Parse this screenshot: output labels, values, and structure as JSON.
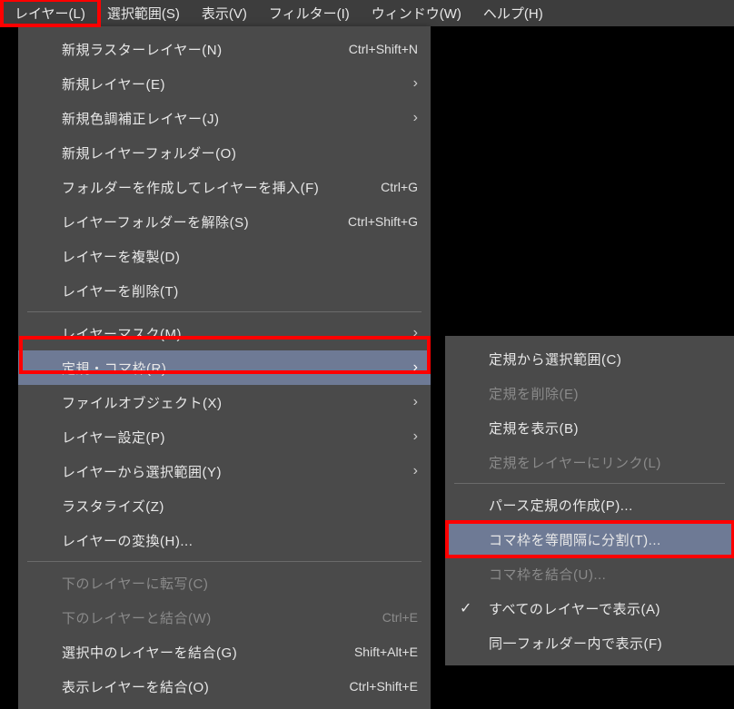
{
  "menubar": [
    "レイヤー(L)",
    "選択範囲(S)",
    "表示(V)",
    "フィルター(I)",
    "ウィンドウ(W)",
    "ヘルプ(H)"
  ],
  "mainMenu": {
    "items": [
      {
        "label": "新規ラスターレイヤー(N)",
        "shortcut": "Ctrl+Shift+N"
      },
      {
        "label": "新規レイヤー(E)",
        "arrow": true
      },
      {
        "label": "新規色調補正レイヤー(J)",
        "arrow": true
      },
      {
        "label": "新規レイヤーフォルダー(O)"
      },
      {
        "label": "フォルダーを作成してレイヤーを挿入(F)",
        "shortcut": "Ctrl+G"
      },
      {
        "label": "レイヤーフォルダーを解除(S)",
        "shortcut": "Ctrl+Shift+G"
      },
      {
        "label": "レイヤーを複製(D)"
      },
      {
        "label": "レイヤーを削除(T)"
      },
      {
        "sep": true
      },
      {
        "label": "レイヤーマスク(M)",
        "arrow": true
      },
      {
        "label": "定規・コマ枠(R)",
        "arrow": true,
        "highlighted": true
      },
      {
        "label": "ファイルオブジェクト(X)",
        "arrow": true
      },
      {
        "label": "レイヤー設定(P)",
        "arrow": true
      },
      {
        "label": "レイヤーから選択範囲(Y)",
        "arrow": true
      },
      {
        "label": "ラスタライズ(Z)"
      },
      {
        "label": "レイヤーの変換(H)..."
      },
      {
        "sep": true
      },
      {
        "label": "下のレイヤーに転写(C)",
        "disabled": true
      },
      {
        "label": "下のレイヤーと結合(W)",
        "shortcut": "Ctrl+E",
        "disabled": true
      },
      {
        "label": "選択中のレイヤーを結合(G)",
        "shortcut": "Shift+Alt+E"
      },
      {
        "label": "表示レイヤーを結合(O)",
        "shortcut": "Ctrl+Shift+E"
      }
    ]
  },
  "subMenu": {
    "items": [
      {
        "label": "定規から選択範囲(C)"
      },
      {
        "label": "定規を削除(E)",
        "disabled": true
      },
      {
        "label": "定規を表示(B)"
      },
      {
        "label": "定規をレイヤーにリンク(L)",
        "disabled": true
      },
      {
        "sep": true
      },
      {
        "label": "パース定規の作成(P)..."
      },
      {
        "label": "コマ枠を等間隔に分割(T)...",
        "highlighted": true
      },
      {
        "label": "コマ枠を結合(U)...",
        "disabled": true
      },
      {
        "label": "すべてのレイヤーで表示(A)",
        "check": true
      },
      {
        "label": "同一フォルダー内で表示(F)"
      }
    ]
  }
}
